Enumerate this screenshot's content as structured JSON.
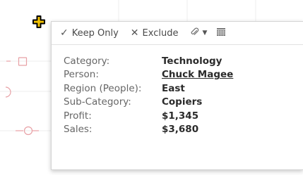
{
  "toolbar": {
    "keep_only_label": "Keep Only",
    "exclude_label": "Exclude"
  },
  "tooltip": {
    "rows": [
      {
        "label": "Category:",
        "value": "Technology"
      },
      {
        "label": "Person:",
        "value": "Chuck Magee"
      },
      {
        "label": "Region (People):",
        "value": "East"
      },
      {
        "label": "Sub-Category:",
        "value": "Copiers"
      },
      {
        "label": "Profit:",
        "value": "$1,345"
      },
      {
        "label": "Sales:",
        "value": "$3,680"
      }
    ]
  },
  "colors": {
    "marker_outline": "#e8a0a5",
    "gridline": "#eeeeee",
    "pointer": "#000000",
    "pointer_fill": "#f2c200"
  },
  "icons": [
    "check-icon",
    "x-icon",
    "paperclip-icon",
    "table-view-icon",
    "crosshair-pointer-icon"
  ]
}
